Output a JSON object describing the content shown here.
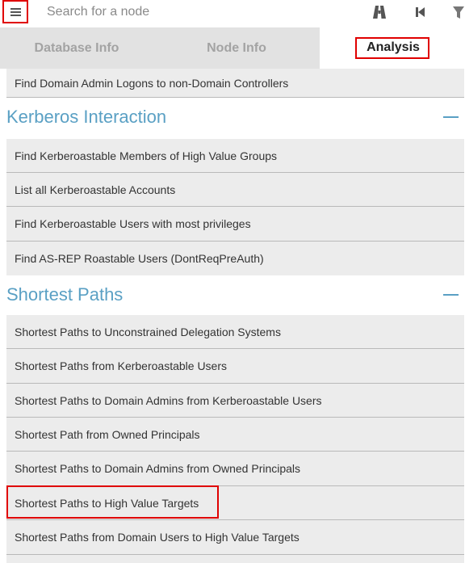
{
  "search": {
    "placeholder": "Search for a node"
  },
  "icons": {
    "menu": "hamburger-menu-icon",
    "path": "pathfinding-icon",
    "back": "back-icon",
    "filter": "filter-icon"
  },
  "colors": {
    "accent": "#5aa0c4",
    "highlight": "#e00000",
    "tab_inactive": "#e2e2e2",
    "item_bg": "#ececec"
  },
  "tabs": [
    {
      "label": "Database Info",
      "active": false
    },
    {
      "label": "Node Info",
      "active": false
    },
    {
      "label": "Analysis",
      "active": true
    }
  ],
  "queries_top": [
    {
      "label": "Find Domain Admin Logons to non-Domain Controllers"
    }
  ],
  "sections": [
    {
      "title": "Kerberos Interaction",
      "collapse_symbol": "—",
      "items": [
        {
          "label": "Find Kerberoastable Members of High Value Groups"
        },
        {
          "label": "List all Kerberoastable Accounts"
        },
        {
          "label": "Find Kerberoastable Users with most privileges"
        },
        {
          "label": "Find AS-REP Roastable Users (DontReqPreAuth)"
        }
      ]
    },
    {
      "title": "Shortest Paths",
      "collapse_symbol": "—",
      "items": [
        {
          "label": "Shortest Paths to Unconstrained Delegation Systems"
        },
        {
          "label": "Shortest Paths from Kerberoastable Users"
        },
        {
          "label": "Shortest Paths to Domain Admins from Kerberoastable Users"
        },
        {
          "label": "Shortest Path from Owned Principals"
        },
        {
          "label": "Shortest Paths to Domain Admins from Owned Principals"
        },
        {
          "label": "Shortest Paths to High Value Targets",
          "highlighted": true
        },
        {
          "label": "Shortest Paths from Domain Users to High Value Targets"
        }
      ]
    }
  ]
}
